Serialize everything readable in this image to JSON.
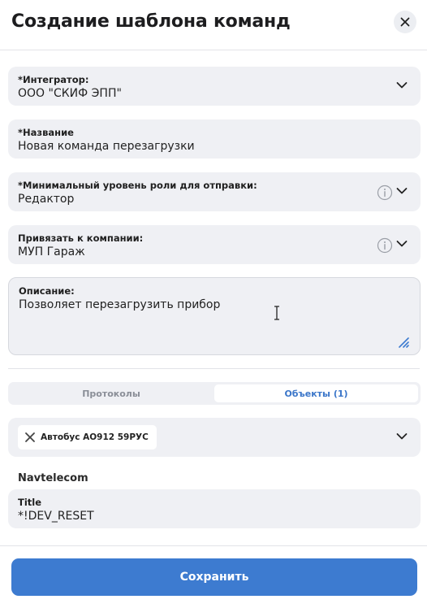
{
  "dialog": {
    "title": "Создание шаблона команд"
  },
  "fields": {
    "integrator": {
      "label": "*Интегратор:",
      "value": "ООО \"СКИФ ЭПП\""
    },
    "name": {
      "label": "*Название",
      "value": "Новая команда перезагрузки"
    },
    "min_role": {
      "label": "*Минимальный уровень роли для отправки:",
      "value": "Редактор"
    },
    "company": {
      "label": "Привязать к компании:",
      "value": "МУП Гараж"
    },
    "description": {
      "label": "Описание:",
      "value": "Позволяет перезагрузить прибор"
    }
  },
  "tabs": [
    {
      "label": "Протоколы",
      "active": false
    },
    {
      "label": "Объекты (1)",
      "active": true
    }
  ],
  "objects": {
    "selected_chip": "Автобус АО912 59РУС"
  },
  "protocol_section": {
    "name": "Navtelecom",
    "title_field": {
      "label": "Title",
      "value": "*!DEV_RESET"
    }
  },
  "footer": {
    "save_label": "Сохранить"
  },
  "colors": {
    "accent": "#3d7bd0",
    "field_bg": "#eff0f4",
    "active_tab_text": "#3b76c9"
  },
  "icons": [
    "close-icon",
    "chevron-down-icon",
    "info-icon",
    "resize-handle-icon",
    "remove-chip-icon",
    "text-cursor-icon"
  ]
}
